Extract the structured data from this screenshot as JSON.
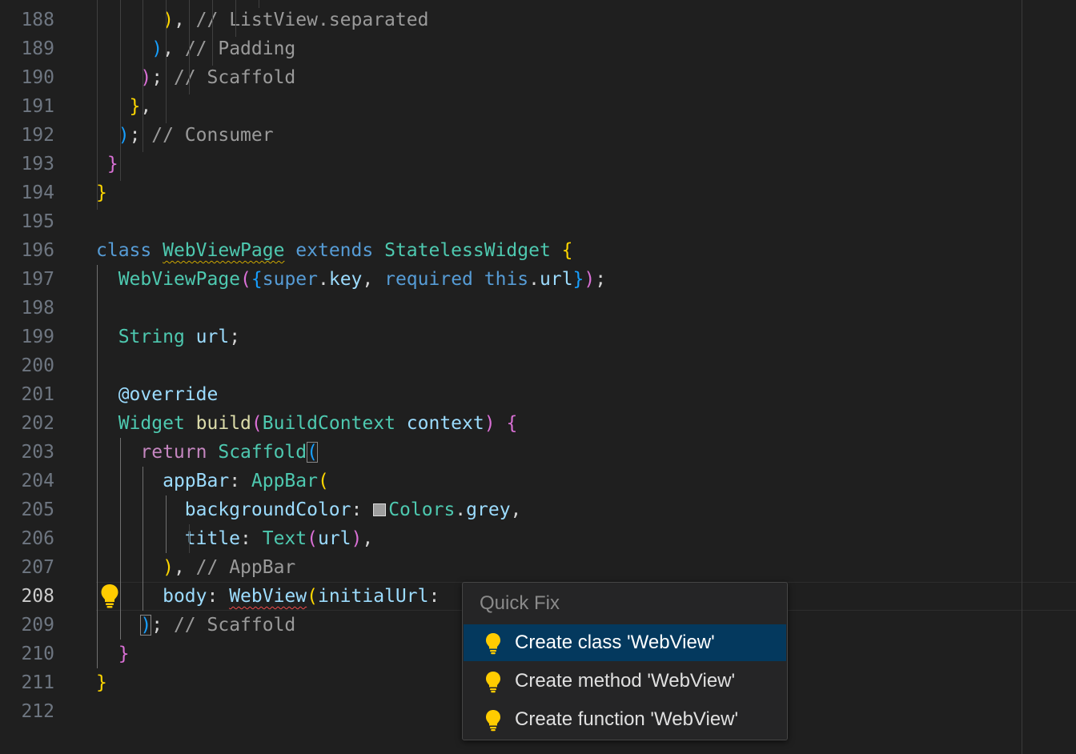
{
  "editor": {
    "line_numbers": [
      "188",
      "189",
      "190",
      "191",
      "192",
      "193",
      "194",
      "195",
      "196",
      "197",
      "198",
      "199",
      "200",
      "201",
      "202",
      "203",
      "204",
      "205",
      "206",
      "207",
      "208",
      "209",
      "210",
      "211",
      "212"
    ],
    "current_line": "208",
    "lines": [
      [
        {
          "t": "      ",
          "c": "plain"
        },
        {
          "t": ")",
          "c": "brY"
        },
        {
          "t": ", ",
          "c": "plain"
        },
        {
          "t": "// ListView.separated",
          "c": "comment"
        }
      ],
      [
        {
          "t": "     ",
          "c": "plain"
        },
        {
          "t": ")",
          "c": "brB"
        },
        {
          "t": ", ",
          "c": "plain"
        },
        {
          "t": "// Padding",
          "c": "comment"
        }
      ],
      [
        {
          "t": "    ",
          "c": "plain"
        },
        {
          "t": ")",
          "c": "brP"
        },
        {
          "t": "; ",
          "c": "plain"
        },
        {
          "t": "// Scaffold",
          "c": "comment"
        }
      ],
      [
        {
          "t": "   ",
          "c": "plain"
        },
        {
          "t": "}",
          "c": "brY"
        },
        {
          "t": ",",
          "c": "plain"
        }
      ],
      [
        {
          "t": "  ",
          "c": "plain"
        },
        {
          "t": ")",
          "c": "brB"
        },
        {
          "t": "; ",
          "c": "plain"
        },
        {
          "t": "// Consumer",
          "c": "comment"
        }
      ],
      [
        {
          "t": " ",
          "c": "plain"
        },
        {
          "t": "}",
          "c": "brP"
        }
      ],
      [
        {
          "t": "}",
          "c": "brY"
        }
      ],
      [],
      [
        {
          "t": "class",
          "c": "keyword"
        },
        {
          "t": " ",
          "c": "plain"
        },
        {
          "t": "WebViewPage",
          "c": "type",
          "sq": "y"
        },
        {
          "t": " ",
          "c": "plain"
        },
        {
          "t": "extends",
          "c": "keyword"
        },
        {
          "t": " ",
          "c": "plain"
        },
        {
          "t": "StatelessWidget",
          "c": "type"
        },
        {
          "t": " ",
          "c": "plain"
        },
        {
          "t": "{",
          "c": "brY"
        }
      ],
      [
        {
          "t": "  ",
          "c": "plain"
        },
        {
          "t": "WebViewPage",
          "c": "type"
        },
        {
          "t": "(",
          "c": "brP"
        },
        {
          "t": "{",
          "c": "brB"
        },
        {
          "t": "super",
          "c": "keyword"
        },
        {
          "t": ".",
          "c": "plain"
        },
        {
          "t": "key",
          "c": "var"
        },
        {
          "t": ", ",
          "c": "plain"
        },
        {
          "t": "required",
          "c": "keyword"
        },
        {
          "t": " ",
          "c": "plain"
        },
        {
          "t": "this",
          "c": "keyword"
        },
        {
          "t": ".",
          "c": "plain"
        },
        {
          "t": "url",
          "c": "var"
        },
        {
          "t": "}",
          "c": "brB"
        },
        {
          "t": ")",
          "c": "brP"
        },
        {
          "t": ";",
          "c": "plain"
        }
      ],
      [],
      [
        {
          "t": "  ",
          "c": "plain"
        },
        {
          "t": "String",
          "c": "type"
        },
        {
          "t": " ",
          "c": "plain"
        },
        {
          "t": "url",
          "c": "var"
        },
        {
          "t": ";",
          "c": "plain"
        }
      ],
      [],
      [
        {
          "t": "  ",
          "c": "plain"
        },
        {
          "t": "@override",
          "c": "var"
        }
      ],
      [
        {
          "t": "  ",
          "c": "plain"
        },
        {
          "t": "Widget",
          "c": "type"
        },
        {
          "t": " ",
          "c": "plain"
        },
        {
          "t": "build",
          "c": "func"
        },
        {
          "t": "(",
          "c": "brP"
        },
        {
          "t": "BuildContext",
          "c": "type"
        },
        {
          "t": " ",
          "c": "plain"
        },
        {
          "t": "context",
          "c": "var"
        },
        {
          "t": ")",
          "c": "brP"
        },
        {
          "t": " ",
          "c": "plain"
        },
        {
          "t": "{",
          "c": "brP"
        }
      ],
      [
        {
          "t": "    ",
          "c": "plain"
        },
        {
          "t": "return",
          "c": "control"
        },
        {
          "t": " ",
          "c": "plain"
        },
        {
          "t": "Scaffold",
          "c": "type"
        },
        {
          "t": "(",
          "c": "brB",
          "match": true
        }
      ],
      [
        {
          "t": "      ",
          "c": "plain"
        },
        {
          "t": "appBar",
          "c": "var"
        },
        {
          "t": ": ",
          "c": "plain"
        },
        {
          "t": "AppBar",
          "c": "type"
        },
        {
          "t": "(",
          "c": "brY"
        }
      ],
      [
        {
          "t": "        ",
          "c": "plain"
        },
        {
          "t": "backgroundColor",
          "c": "var"
        },
        {
          "t": ": ",
          "c": "plain"
        },
        {
          "t": "",
          "c": "swatch"
        },
        {
          "t": "Colors",
          "c": "type"
        },
        {
          "t": ".",
          "c": "plain"
        },
        {
          "t": "grey",
          "c": "var"
        },
        {
          "t": ",",
          "c": "plain"
        }
      ],
      [
        {
          "t": "        ",
          "c": "plain"
        },
        {
          "t": "title",
          "c": "var"
        },
        {
          "t": ": ",
          "c": "plain"
        },
        {
          "t": "Text",
          "c": "type"
        },
        {
          "t": "(",
          "c": "brP"
        },
        {
          "t": "url",
          "c": "var"
        },
        {
          "t": ")",
          "c": "brP"
        },
        {
          "t": ",",
          "c": "plain"
        }
      ],
      [
        {
          "t": "      ",
          "c": "plain"
        },
        {
          "t": ")",
          "c": "brY"
        },
        {
          "t": ", ",
          "c": "plain"
        },
        {
          "t": "// AppBar",
          "c": "comment"
        }
      ],
      [
        {
          "t": "      ",
          "c": "plain"
        },
        {
          "t": "body",
          "c": "var"
        },
        {
          "t": ": ",
          "c": "plain"
        },
        {
          "t": "WebView",
          "c": "var",
          "sq": "r"
        },
        {
          "t": "(",
          "c": "brY"
        },
        {
          "t": "initialUrl",
          "c": "var"
        },
        {
          "t": ":",
          "c": "plain"
        }
      ],
      [
        {
          "t": "    ",
          "c": "plain"
        },
        {
          "t": ")",
          "c": "brB",
          "match": true
        },
        {
          "t": "; ",
          "c": "plain"
        },
        {
          "t": "// Scaffold",
          "c": "comment"
        }
      ],
      [
        {
          "t": "  ",
          "c": "plain"
        },
        {
          "t": "}",
          "c": "brP"
        }
      ],
      [
        {
          "t": "}",
          "c": "brY"
        }
      ],
      []
    ]
  },
  "colors": {
    "plain": "#d4d4d4",
    "comment": "#9a9a9a",
    "keyword": "#569cd6",
    "control": "#c586c0",
    "type": "#4ec9b0",
    "var": "#9cdcfe",
    "func": "#dcdcaa",
    "brY": "#ffd700",
    "brP": "#da70d6",
    "brB": "#179fff",
    "bulb": "#ffcc00"
  },
  "quick_fix": {
    "title": "Quick Fix",
    "items": [
      {
        "label": "Create class 'WebView'",
        "selected": true
      },
      {
        "label": "Create method 'WebView'",
        "selected": false
      },
      {
        "label": "Create function 'WebView'",
        "selected": false
      }
    ]
  }
}
